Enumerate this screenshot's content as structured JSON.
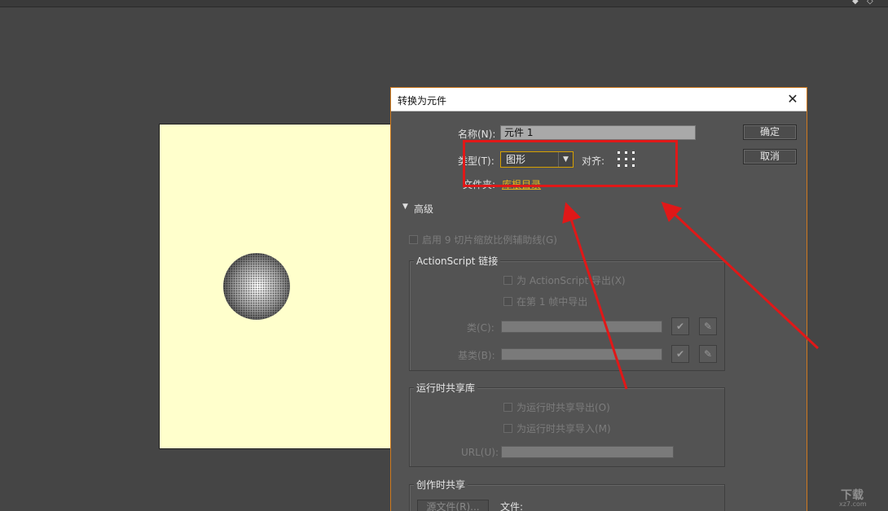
{
  "dialog": {
    "title": "转换为元件",
    "close_glyph": "✕",
    "name_label": "名称(N):",
    "name_value": "元件 1",
    "type_label": "类型(T):",
    "type_value": "图形",
    "align_label": "对齐:",
    "folder_label": "文件夹:",
    "folder_value": "库根目录",
    "ok_label": "确定",
    "cancel_label": "取消",
    "advanced_label": "高级",
    "enable_9slice_label": "启用 9 切片缩放比例辅助线(G)",
    "actionscript": {
      "title": "ActionScript 链接",
      "export_label": "为 ActionScript 导出(X)",
      "frame1_label": "在第 1 帧中导出",
      "class_label": "类(C):",
      "base_class_label": "基类(B):"
    },
    "runtime_share": {
      "title": "运行时共享库",
      "export_label": "为运行时共享导出(O)",
      "import_label": "为运行时共享导入(M)",
      "url_label": "URL(U):"
    },
    "authoring_share": {
      "title": "创作时共享",
      "source_button": "源文件(R)...",
      "file_label": "文件:"
    }
  },
  "watermark": {
    "line1": "下载",
    "line2": "xz7.com"
  },
  "colors": {
    "accent_border": "#d07a1e",
    "annotation_red": "#e01818",
    "link_gold": "#e8b31a",
    "stage_bg": "#ffffcc"
  }
}
